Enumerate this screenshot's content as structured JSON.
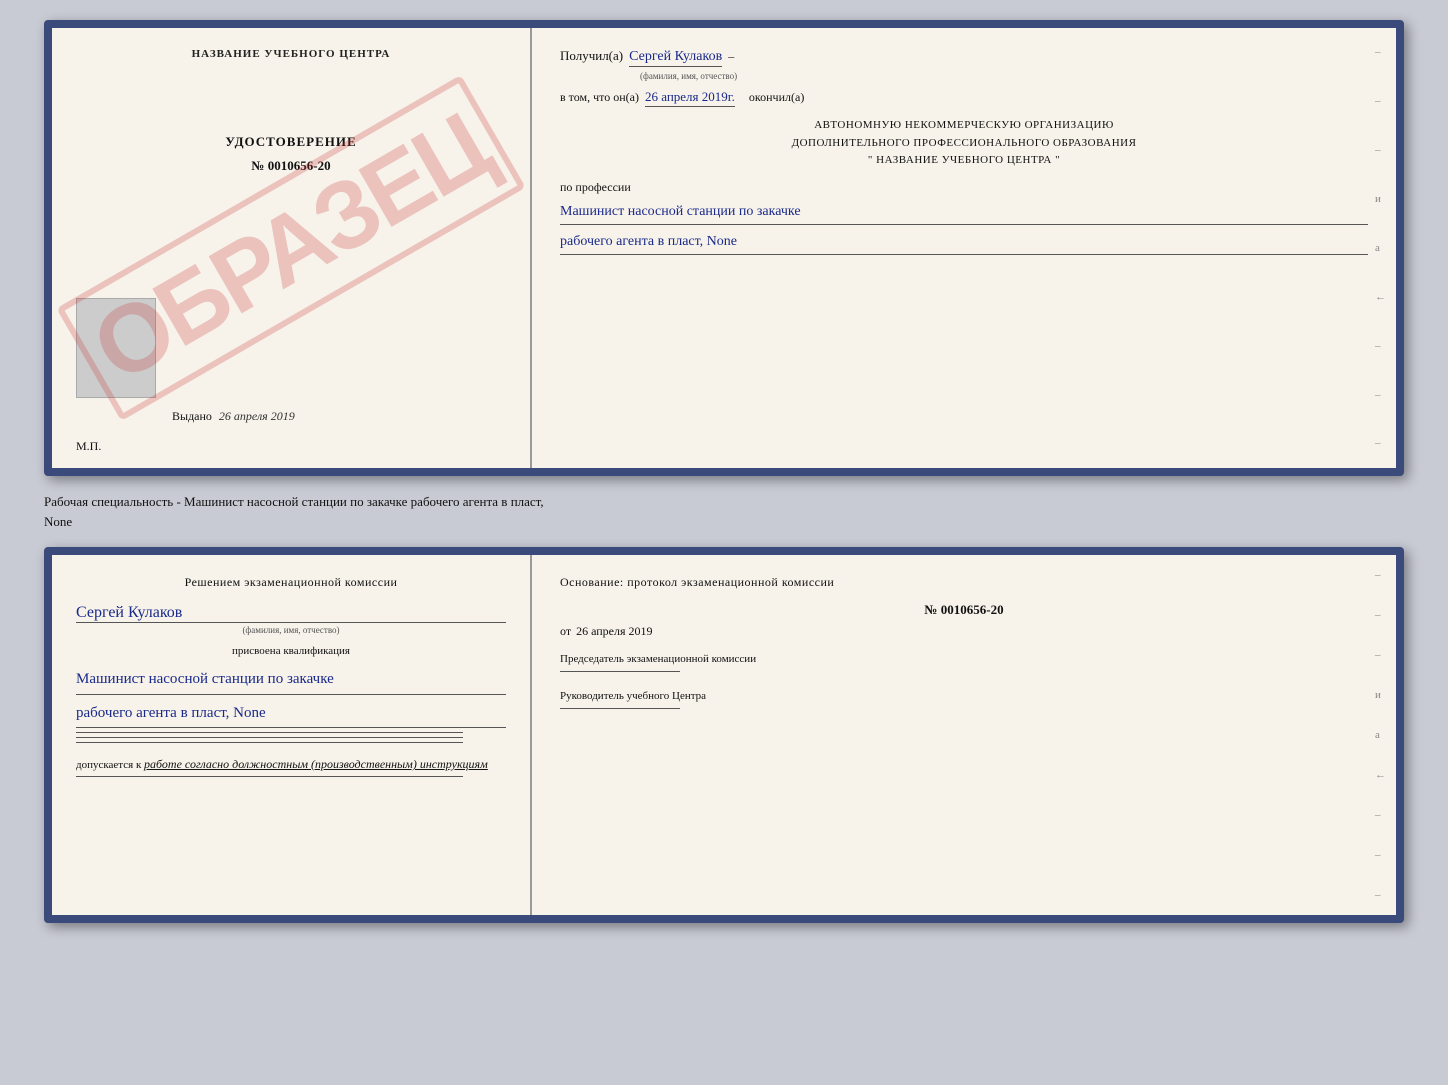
{
  "top_cert": {
    "left": {
      "title": "НАЗВАНИЕ УЧЕБНОГО ЦЕНТРА",
      "watermark": "ОБРАЗЕЦ",
      "udost_label": "УДОСТОВЕРЕНИЕ",
      "udost_number": "№ 0010656-20",
      "vydano_prefix": "Выдано",
      "vydano_date": "26 апреля 2019",
      "mp_label": "М.П."
    },
    "right": {
      "poluchil_prefix": "Получил(а)",
      "poluchil_name": "Сергей Кулаков",
      "familiya_hint": "(фамилия, имя, отчество)",
      "vtom_prefix": "в том, что он(а)",
      "vtom_date": "26 апреля 2019г.",
      "okonchil": "окончил(а)",
      "org_line1": "АВТОНОМНУЮ НЕКОММЕРЧЕСКУЮ ОРГАНИЗАЦИЮ",
      "org_line2": "ДОПОЛНИТЕЛЬНОГО ПРОФЕССИОНАЛЬНОГО ОБРАЗОВАНИЯ",
      "org_line3": "\"   НАЗВАНИЕ УЧЕБНОГО ЦЕНТРА   \"",
      "po_professii": "по профессии",
      "profession_line1": "Машинист насосной станции по закачке",
      "profession_line2": "рабочего агента в пласт, None",
      "side_marks": [
        "-",
        "-",
        "-",
        "и",
        "а",
        "←",
        "-",
        "-",
        "-"
      ]
    }
  },
  "specialty_text": "Рабочая специальность - Машинист насосной станции по закачке рабочего агента в пласт,",
  "specialty_text2": "None",
  "bottom_cert": {
    "left": {
      "komissia_title": "Решением экзаменационной комиссии",
      "name": "Сергей Кулаков",
      "name_hint": "(фамилия, имя, отчество)",
      "prisvoyena": "присвоена квалификация",
      "kvalif_line1": "Машинист насосной станции по закачке",
      "kvalif_line2": "рабочего агента в пласт, None",
      "bottom_lines": [
        "_________________________",
        "_________________________",
        "_________________________"
      ],
      "dopuskaetsya_prefix": "допускается к",
      "dopuskaetsya_text": "работе согласно должностным (производственным) инструкциям"
    },
    "right": {
      "osnov_title": "Основание: протокол экзаменационной комиссии",
      "protocol_number": "№ 0010656-20",
      "ot_prefix": "от",
      "ot_date": "26 апреля 2019",
      "predsedatel_label": "Председатель экзаменационной комиссии",
      "rukovoditel_label": "Руководитель учебного Центра",
      "side_marks": [
        "-",
        "-",
        "-",
        "и",
        "а",
        "←",
        "-",
        "-",
        "-"
      ]
    }
  }
}
